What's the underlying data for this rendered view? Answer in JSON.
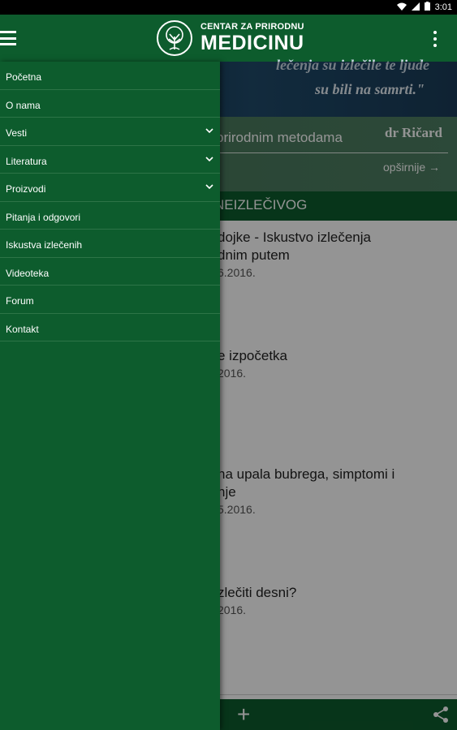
{
  "status_bar": {
    "time": "3:01"
  },
  "app_bar": {
    "logo_subtitle": "CENTAR ZA PRIRODNU",
    "logo_title": "MEDICINU"
  },
  "hero": {
    "quote_line1": "lečenja su izlečile te ljude",
    "quote_line2": "su bili na samrti.\""
  },
  "banner": {
    "text": "prirodnim metodama",
    "author": "dr Ričard",
    "more_link": "opširnije →"
  },
  "section": {
    "title": "NEIZLEČIVOG"
  },
  "articles": [
    {
      "title": "dojke - Iskustvo izlečenja\ndnim putem",
      "date": "6.2016."
    },
    {
      "title": "e izpočetka",
      "date": "2016."
    },
    {
      "title": "na upala bubrega, simptomi i\nnje",
      "date": "5.2016."
    },
    {
      "title": "zlečiti desni?",
      "date": "2016."
    }
  ],
  "drawer": {
    "items": [
      {
        "label": "Početna",
        "has_submenu": false
      },
      {
        "label": "O nama",
        "has_submenu": false
      },
      {
        "label": "Vesti",
        "has_submenu": true
      },
      {
        "label": "Literatura",
        "has_submenu": true
      },
      {
        "label": "Proizvodi",
        "has_submenu": true
      },
      {
        "label": "Pitanja i odgovori",
        "has_submenu": false
      },
      {
        "label": "Iskustva izlečenih",
        "has_submenu": false
      },
      {
        "label": "Videoteka",
        "has_submenu": false
      },
      {
        "label": "Forum",
        "has_submenu": false
      },
      {
        "label": "Kontakt",
        "has_submenu": false
      }
    ]
  },
  "colors": {
    "primary_green": "#0d5c2d",
    "drawer_divider": "#2d7447",
    "status_bar": "#000000"
  },
  "icons": {
    "menu": "hamburger-icon",
    "overflow": "more-vert-icon",
    "add": "plus-icon",
    "share": "share-icon",
    "chevron": "chevron-down-icon",
    "logo": "tree-logo-icon"
  }
}
